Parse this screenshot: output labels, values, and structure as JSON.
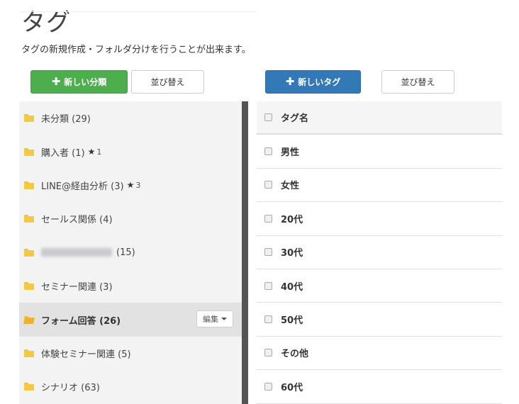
{
  "page": {
    "title": "タグ",
    "subtitle": "タグの新規作成・フォルダ分けを行うことが出来ます。"
  },
  "toolbar": {
    "new_category_label": "新しい分類",
    "sort_left_label": "並び替え",
    "new_tag_label": "新しいタグ",
    "sort_right_label": "並び替え"
  },
  "folders": [
    {
      "label": "未分類 (29)",
      "star": "",
      "star_count": ""
    },
    {
      "label": "購入者 (1)",
      "star": "★",
      "star_count": "1"
    },
    {
      "label": "LINE@経由分析 (3)",
      "star": "★",
      "star_count": "3"
    },
    {
      "label": "セールス関係 (4)",
      "star": "",
      "star_count": ""
    },
    {
      "label": "(15)",
      "star": "",
      "star_count": ""
    },
    {
      "label": "セミナー関連 (3)",
      "star": "",
      "star_count": ""
    },
    {
      "label": "フォーム回答 (26)",
      "star": "",
      "star_count": ""
    },
    {
      "label": "体験セミナー関連 (5)",
      "star": "",
      "star_count": ""
    },
    {
      "label": "シナリオ (63)",
      "star": "",
      "star_count": ""
    }
  ],
  "edit_button_label": "編集",
  "tag_table": {
    "header": "タグ名",
    "rows": [
      "男性",
      "女性",
      "20代",
      "30代",
      "40代",
      "50代",
      "その他",
      "60代"
    ]
  },
  "colors": {
    "green_button": "#4cae4c",
    "blue_button": "#3479b7",
    "divider": "#555555",
    "folder": "#f5c842"
  }
}
